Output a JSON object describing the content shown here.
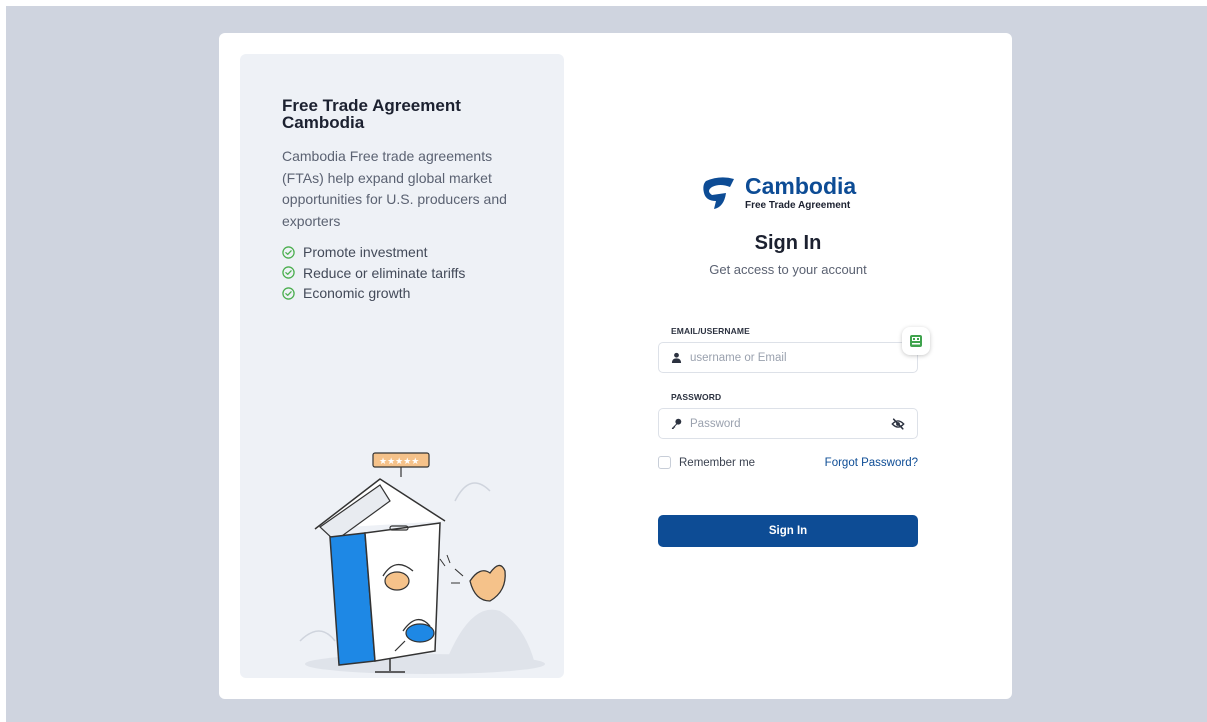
{
  "colors": {
    "brand": "#0d4c95",
    "backdrop": "#cfd4df",
    "panel": "#eef1f6",
    "check": "#4caf50"
  },
  "promo": {
    "title": "Free Trade Agreement Cambodia",
    "description": "Cambodia Free trade agreements (FTAs) help expand global market opportunities for U.S. producers and exporters",
    "benefits": [
      {
        "label": "Promote investment",
        "icon": "check-circle-icon"
      },
      {
        "label": "Reduce or eliminate tariffs",
        "icon": "check-circle-icon"
      },
      {
        "label": "Economic growth",
        "icon": "check-circle-icon"
      }
    ]
  },
  "logo": {
    "name": "Cambodia",
    "subtitle": "Free Trade Agreement"
  },
  "signin": {
    "title": "Sign In",
    "subtitle": "Get access to your account",
    "email_label": "EMAIL/USERNAME",
    "email_placeholder": "username or Email",
    "email_value": "",
    "password_label": "PASSWORD",
    "password_placeholder": "Password",
    "password_value": "",
    "remember_label": "Remember me",
    "remember_checked": false,
    "forgot_label": "Forgot Password?",
    "submit_label": "Sign In"
  }
}
